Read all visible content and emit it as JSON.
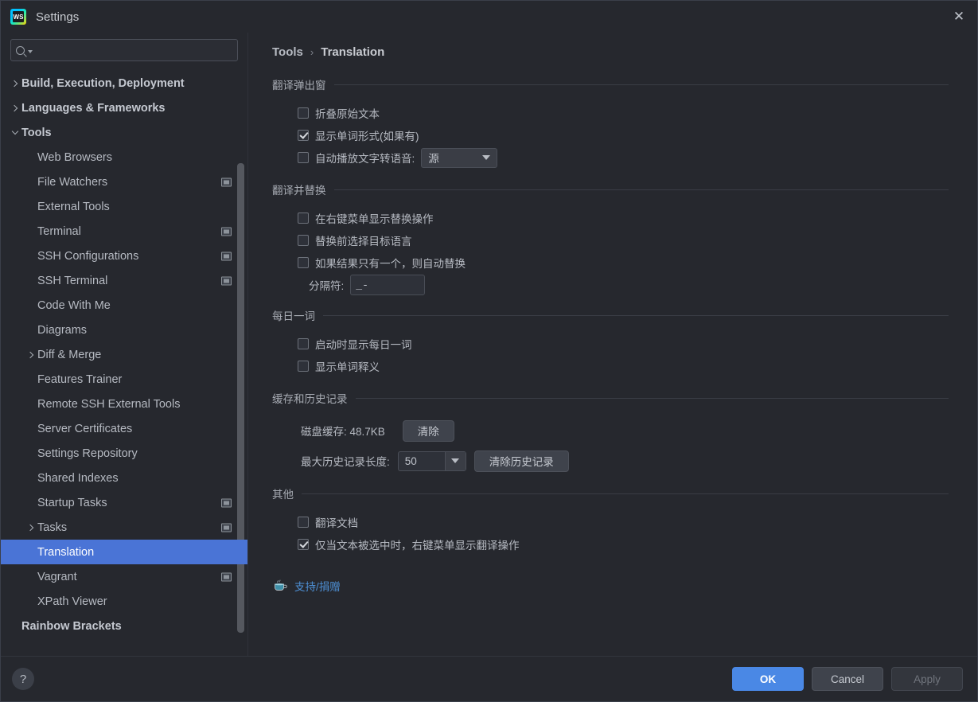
{
  "window": {
    "title": "Settings",
    "logo_icon": "webstorm-logo-icon",
    "close_icon": "close-icon"
  },
  "sidebar": {
    "search": {
      "placeholder": "",
      "value": "",
      "icon": "search-icon"
    },
    "items": [
      {
        "label": "Build, Execution, Deployment",
        "indent": 0,
        "arrow": "right",
        "bold": true,
        "badge": false,
        "selected": false
      },
      {
        "label": "Languages & Frameworks",
        "indent": 0,
        "arrow": "right",
        "bold": true,
        "badge": false,
        "selected": false
      },
      {
        "label": "Tools",
        "indent": 0,
        "arrow": "down",
        "bold": true,
        "badge": false,
        "selected": false
      },
      {
        "label": "Web Browsers",
        "indent": 1,
        "arrow": "none",
        "bold": false,
        "badge": false,
        "selected": false
      },
      {
        "label": "File Watchers",
        "indent": 1,
        "arrow": "none",
        "bold": false,
        "badge": true,
        "selected": false
      },
      {
        "label": "External Tools",
        "indent": 1,
        "arrow": "none",
        "bold": false,
        "badge": false,
        "selected": false
      },
      {
        "label": "Terminal",
        "indent": 1,
        "arrow": "none",
        "bold": false,
        "badge": true,
        "selected": false
      },
      {
        "label": "SSH Configurations",
        "indent": 1,
        "arrow": "none",
        "bold": false,
        "badge": true,
        "selected": false
      },
      {
        "label": "SSH Terminal",
        "indent": 1,
        "arrow": "none",
        "bold": false,
        "badge": true,
        "selected": false
      },
      {
        "label": "Code With Me",
        "indent": 1,
        "arrow": "none",
        "bold": false,
        "badge": false,
        "selected": false
      },
      {
        "label": "Diagrams",
        "indent": 1,
        "arrow": "none",
        "bold": false,
        "badge": false,
        "selected": false
      },
      {
        "label": "Diff & Merge",
        "indent": 1,
        "arrow": "right",
        "bold": false,
        "badge": false,
        "selected": false
      },
      {
        "label": "Features Trainer",
        "indent": 1,
        "arrow": "none",
        "bold": false,
        "badge": false,
        "selected": false
      },
      {
        "label": "Remote SSH External Tools",
        "indent": 1,
        "arrow": "none",
        "bold": false,
        "badge": false,
        "selected": false
      },
      {
        "label": "Server Certificates",
        "indent": 1,
        "arrow": "none",
        "bold": false,
        "badge": false,
        "selected": false
      },
      {
        "label": "Settings Repository",
        "indent": 1,
        "arrow": "none",
        "bold": false,
        "badge": false,
        "selected": false
      },
      {
        "label": "Shared Indexes",
        "indent": 1,
        "arrow": "none",
        "bold": false,
        "badge": false,
        "selected": false
      },
      {
        "label": "Startup Tasks",
        "indent": 1,
        "arrow": "none",
        "bold": false,
        "badge": true,
        "selected": false
      },
      {
        "label": "Tasks",
        "indent": 1,
        "arrow": "right",
        "bold": false,
        "badge": true,
        "selected": false
      },
      {
        "label": "Translation",
        "indent": 1,
        "arrow": "none",
        "bold": false,
        "badge": false,
        "selected": true
      },
      {
        "label": "Vagrant",
        "indent": 1,
        "arrow": "none",
        "bold": false,
        "badge": true,
        "selected": false
      },
      {
        "label": "XPath Viewer",
        "indent": 1,
        "arrow": "none",
        "bold": false,
        "badge": false,
        "selected": false
      },
      {
        "label": "Rainbow Brackets",
        "indent": 0,
        "arrow": "none",
        "bold": true,
        "badge": false,
        "selected": false
      }
    ]
  },
  "main": {
    "breadcrumb": {
      "parent": "Tools",
      "separator": "›",
      "current": "Translation"
    },
    "sections": [
      {
        "title": "翻译弹出窗",
        "rows": [
          {
            "kind": "checkbox",
            "checked": false,
            "label": "折叠原始文本"
          },
          {
            "kind": "checkbox",
            "checked": true,
            "label": "显示单词形式(如果有)"
          },
          {
            "kind": "checkbox-combo",
            "checked": false,
            "label": "自动播放文字转语音:",
            "combo_value": "源"
          }
        ]
      },
      {
        "title": "翻译并替换",
        "rows": [
          {
            "kind": "checkbox",
            "checked": false,
            "label": "在右键菜单显示替换操作"
          },
          {
            "kind": "checkbox",
            "checked": false,
            "label": "替换前选择目标语言"
          },
          {
            "kind": "checkbox",
            "checked": false,
            "label": "如果结果只有一个，则自动替换"
          },
          {
            "kind": "field",
            "label": "分隔符:",
            "value": "_-"
          }
        ]
      },
      {
        "title": "每日一词",
        "rows": [
          {
            "kind": "checkbox",
            "checked": false,
            "label": "启动时显示每日一词"
          },
          {
            "kind": "checkbox",
            "checked": false,
            "label": "显示单词释义"
          }
        ]
      },
      {
        "title": "缓存和历史记录",
        "rows": [
          {
            "kind": "cache",
            "label": "磁盘缓存: 48.7KB",
            "button": "清除"
          },
          {
            "kind": "history",
            "label": "最大历史记录长度:",
            "combo_value": "50",
            "button": "清除历史记录"
          }
        ]
      },
      {
        "title": "其他",
        "rows": [
          {
            "kind": "checkbox",
            "checked": false,
            "label": "翻译文档"
          },
          {
            "kind": "checkbox",
            "checked": true,
            "label": "仅当文本被选中时，右键菜单显示翻译操作"
          }
        ]
      }
    ],
    "support": {
      "icon": "coffee-cup-icon",
      "label": "支持/捐赠"
    }
  },
  "footer": {
    "help_label": "?",
    "ok_label": "OK",
    "cancel_label": "Cancel",
    "apply_label": "Apply"
  },
  "colors": {
    "accent": "#4a88e5",
    "selection": "#4a74d6",
    "background": "#26282e",
    "link": "#4d8fd4"
  }
}
